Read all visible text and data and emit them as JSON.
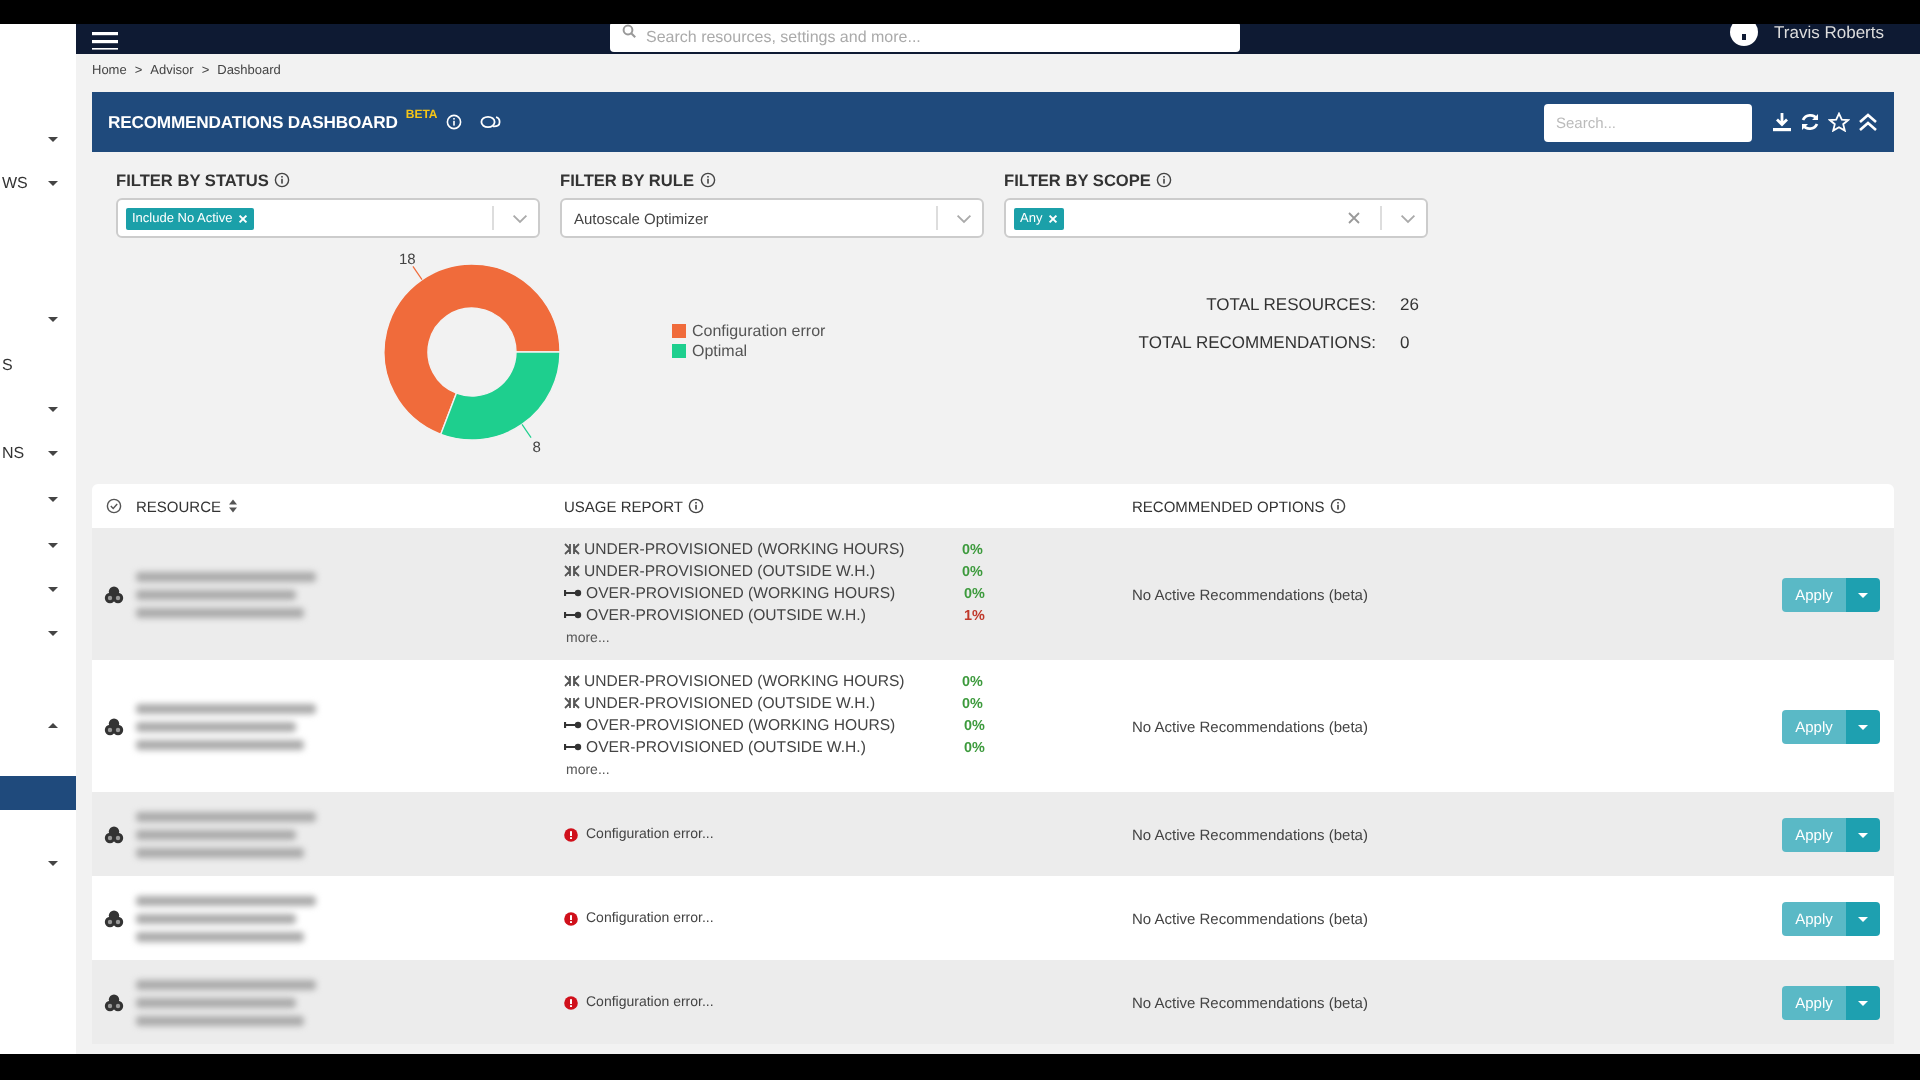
{
  "sidebar": {
    "items": [
      {
        "kind": "group",
        "expanded": false,
        "selected": false
      },
      {
        "kind": "group",
        "label": "WS",
        "expanded": false,
        "selected": false
      },
      {
        "kind": "group",
        "expanded": false,
        "selected": false
      },
      {
        "kind": "link",
        "label": "S",
        "selected": false
      },
      {
        "kind": "group",
        "expanded": false,
        "selected": false
      },
      {
        "kind": "group",
        "label": "NS",
        "expanded": false,
        "selected": false
      },
      {
        "kind": "group",
        "expanded": false,
        "selected": false
      },
      {
        "kind": "group",
        "expanded": false,
        "selected": false
      },
      {
        "kind": "group",
        "expanded": false,
        "selected": false
      },
      {
        "kind": "group",
        "expanded": false,
        "selected": false
      },
      {
        "kind": "group",
        "expanded": true,
        "selected": false
      },
      {
        "kind": "link",
        "selected": true
      },
      {
        "kind": "group",
        "expanded": false,
        "selected": false
      }
    ]
  },
  "top_nav": {
    "search": {
      "placeholder": "Search resources, settings and more..."
    },
    "user": "Travis Roberts"
  },
  "breadcrumb": [
    "Home",
    ">",
    "Advisor",
    ">",
    "Dashboard"
  ],
  "header": {
    "title": "RECOMMENDATIONS DASHBOARD",
    "badge": "BETA",
    "search": {
      "placeholder": "Search..."
    }
  },
  "filters": [
    {
      "label": "FILTER BY STATUS",
      "tags": [
        "Include No Active"
      ],
      "clearable": false
    },
    {
      "label": "FILTER BY RULE",
      "value": "Autoscale Optimizer",
      "clearable": false
    },
    {
      "label": "FILTER BY SCOPE",
      "tags": [
        "Any"
      ],
      "clearable": true
    }
  ],
  "chart": {
    "chart_data": {
      "type": "donut",
      "categories": [
        "Configuration error",
        "Optimal"
      ],
      "series": [
        {
          "values": [
            18,
            8
          ]
        }
      ],
      "colors": [
        "#f06b3b",
        "#1ecf8e"
      ],
      "data_labels": true
    }
  },
  "totals": [
    {
      "label": "TOTAL RESOURCES:",
      "value": "26"
    },
    {
      "label": "TOTAL RECOMMENDATIONS:",
      "value": "0"
    }
  ],
  "table": {
    "columns": [
      "RESOURCE",
      "USAGE REPORT",
      "RECOMMENDED OPTIONS"
    ],
    "rows": [
      {
        "usage": {
          "kind": "metrics",
          "metrics": [
            {
              "kind": "under",
              "label": "UNDER-PROVISIONED (WORKING HOURS)",
              "value": "0%",
              "color": "#3c9a3c"
            },
            {
              "kind": "under",
              "label": "UNDER-PROVISIONED (OUTSIDE W.H.)",
              "value": "0%",
              "color": "#3c9a3c"
            },
            {
              "kind": "over",
              "label": "OVER-PROVISIONED (WORKING HOURS)",
              "value": "0%",
              "color": "#3c9a3c"
            },
            {
              "kind": "over",
              "label": "OVER-PROVISIONED (OUTSIDE W.H.)",
              "value": "1%",
              "color": "#c0392b"
            }
          ],
          "more": "more..."
        },
        "options": "No Active Recommendations (beta)",
        "action": "Apply"
      },
      {
        "usage": {
          "kind": "metrics",
          "metrics": [
            {
              "kind": "under",
              "label": "UNDER-PROVISIONED (WORKING HOURS)",
              "value": "0%",
              "color": "#3c9a3c"
            },
            {
              "kind": "under",
              "label": "UNDER-PROVISIONED (OUTSIDE W.H.)",
              "value": "0%",
              "color": "#3c9a3c"
            },
            {
              "kind": "over",
              "label": "OVER-PROVISIONED (WORKING HOURS)",
              "value": "0%",
              "color": "#3c9a3c"
            },
            {
              "kind": "over",
              "label": "OVER-PROVISIONED (OUTSIDE W.H.)",
              "value": "0%",
              "color": "#3c9a3c"
            }
          ],
          "more": "more..."
        },
        "options": "No Active Recommendations (beta)",
        "action": "Apply"
      },
      {
        "usage": {
          "kind": "error",
          "message": "Configuration error..."
        },
        "options": "No Active Recommendations (beta)",
        "action": "Apply"
      },
      {
        "usage": {
          "kind": "error",
          "message": "Configuration error..."
        },
        "options": "No Active Recommendations (beta)",
        "action": "Apply"
      },
      {
        "usage": {
          "kind": "error",
          "message": "Configuration error..."
        },
        "options": "No Active Recommendations (beta)",
        "action": "Apply"
      }
    ]
  }
}
